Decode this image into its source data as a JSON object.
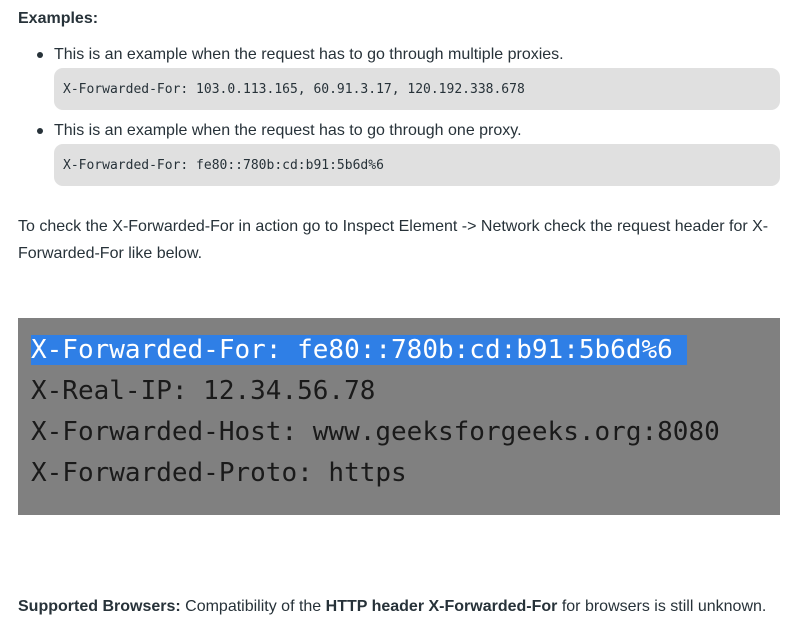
{
  "examples_heading": "Examples:",
  "examples": [
    {
      "text": "This is an example when the request has to go through multiple proxies.",
      "code": "X-Forwarded-For: 103.0.113.165, 60.91.3.17, 120.192.338.678"
    },
    {
      "text": "This is an example when the request has to go through one proxy.",
      "code": "X-Forwarded-For: fe80::780b:cd:b91:5b6d%6"
    }
  ],
  "paragraph": "To check the X-Forwarded-For in action go to Inspect Element -> Network check the request header for X-Forwarded-For like below.",
  "screenshot": {
    "lines": [
      "X-Forwarded-For: fe80::780b:cd:b91:5b6d%6",
      "X-Real-IP: 12.34.56.78",
      "X-Forwarded-Host: www.geeksforgeeks.org:8080",
      "X-Forwarded-Proto: https"
    ],
    "background_color": "#808080",
    "selection_color": "#2f7fe6"
  },
  "footer": {
    "label": "Supported Browsers:",
    "text_before": " Compatibility of the ",
    "highlight": "HTTP header X-Forwarded-For",
    "text_after": " for browsers is still unknown."
  }
}
